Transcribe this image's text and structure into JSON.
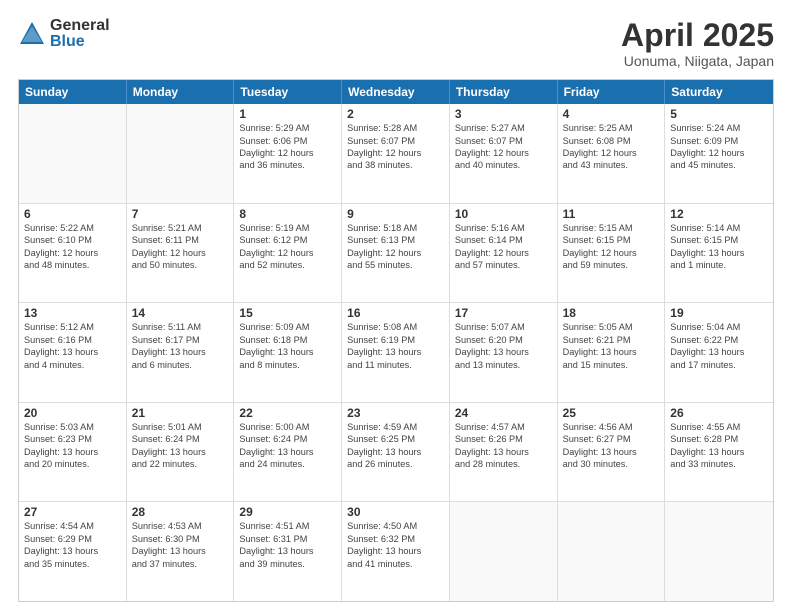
{
  "logo": {
    "general": "General",
    "blue": "Blue"
  },
  "title": "April 2025",
  "subtitle": "Uonuma, Niigata, Japan",
  "headers": [
    "Sunday",
    "Monday",
    "Tuesday",
    "Wednesday",
    "Thursday",
    "Friday",
    "Saturday"
  ],
  "weeks": [
    [
      {
        "day": "",
        "lines": []
      },
      {
        "day": "",
        "lines": []
      },
      {
        "day": "1",
        "lines": [
          "Sunrise: 5:29 AM",
          "Sunset: 6:06 PM",
          "Daylight: 12 hours",
          "and 36 minutes."
        ]
      },
      {
        "day": "2",
        "lines": [
          "Sunrise: 5:28 AM",
          "Sunset: 6:07 PM",
          "Daylight: 12 hours",
          "and 38 minutes."
        ]
      },
      {
        "day": "3",
        "lines": [
          "Sunrise: 5:27 AM",
          "Sunset: 6:07 PM",
          "Daylight: 12 hours",
          "and 40 minutes."
        ]
      },
      {
        "day": "4",
        "lines": [
          "Sunrise: 5:25 AM",
          "Sunset: 6:08 PM",
          "Daylight: 12 hours",
          "and 43 minutes."
        ]
      },
      {
        "day": "5",
        "lines": [
          "Sunrise: 5:24 AM",
          "Sunset: 6:09 PM",
          "Daylight: 12 hours",
          "and 45 minutes."
        ]
      }
    ],
    [
      {
        "day": "6",
        "lines": [
          "Sunrise: 5:22 AM",
          "Sunset: 6:10 PM",
          "Daylight: 12 hours",
          "and 48 minutes."
        ]
      },
      {
        "day": "7",
        "lines": [
          "Sunrise: 5:21 AM",
          "Sunset: 6:11 PM",
          "Daylight: 12 hours",
          "and 50 minutes."
        ]
      },
      {
        "day": "8",
        "lines": [
          "Sunrise: 5:19 AM",
          "Sunset: 6:12 PM",
          "Daylight: 12 hours",
          "and 52 minutes."
        ]
      },
      {
        "day": "9",
        "lines": [
          "Sunrise: 5:18 AM",
          "Sunset: 6:13 PM",
          "Daylight: 12 hours",
          "and 55 minutes."
        ]
      },
      {
        "day": "10",
        "lines": [
          "Sunrise: 5:16 AM",
          "Sunset: 6:14 PM",
          "Daylight: 12 hours",
          "and 57 minutes."
        ]
      },
      {
        "day": "11",
        "lines": [
          "Sunrise: 5:15 AM",
          "Sunset: 6:15 PM",
          "Daylight: 12 hours",
          "and 59 minutes."
        ]
      },
      {
        "day": "12",
        "lines": [
          "Sunrise: 5:14 AM",
          "Sunset: 6:15 PM",
          "Daylight: 13 hours",
          "and 1 minute."
        ]
      }
    ],
    [
      {
        "day": "13",
        "lines": [
          "Sunrise: 5:12 AM",
          "Sunset: 6:16 PM",
          "Daylight: 13 hours",
          "and 4 minutes."
        ]
      },
      {
        "day": "14",
        "lines": [
          "Sunrise: 5:11 AM",
          "Sunset: 6:17 PM",
          "Daylight: 13 hours",
          "and 6 minutes."
        ]
      },
      {
        "day": "15",
        "lines": [
          "Sunrise: 5:09 AM",
          "Sunset: 6:18 PM",
          "Daylight: 13 hours",
          "and 8 minutes."
        ]
      },
      {
        "day": "16",
        "lines": [
          "Sunrise: 5:08 AM",
          "Sunset: 6:19 PM",
          "Daylight: 13 hours",
          "and 11 minutes."
        ]
      },
      {
        "day": "17",
        "lines": [
          "Sunrise: 5:07 AM",
          "Sunset: 6:20 PM",
          "Daylight: 13 hours",
          "and 13 minutes."
        ]
      },
      {
        "day": "18",
        "lines": [
          "Sunrise: 5:05 AM",
          "Sunset: 6:21 PM",
          "Daylight: 13 hours",
          "and 15 minutes."
        ]
      },
      {
        "day": "19",
        "lines": [
          "Sunrise: 5:04 AM",
          "Sunset: 6:22 PM",
          "Daylight: 13 hours",
          "and 17 minutes."
        ]
      }
    ],
    [
      {
        "day": "20",
        "lines": [
          "Sunrise: 5:03 AM",
          "Sunset: 6:23 PM",
          "Daylight: 13 hours",
          "and 20 minutes."
        ]
      },
      {
        "day": "21",
        "lines": [
          "Sunrise: 5:01 AM",
          "Sunset: 6:24 PM",
          "Daylight: 13 hours",
          "and 22 minutes."
        ]
      },
      {
        "day": "22",
        "lines": [
          "Sunrise: 5:00 AM",
          "Sunset: 6:24 PM",
          "Daylight: 13 hours",
          "and 24 minutes."
        ]
      },
      {
        "day": "23",
        "lines": [
          "Sunrise: 4:59 AM",
          "Sunset: 6:25 PM",
          "Daylight: 13 hours",
          "and 26 minutes."
        ]
      },
      {
        "day": "24",
        "lines": [
          "Sunrise: 4:57 AM",
          "Sunset: 6:26 PM",
          "Daylight: 13 hours",
          "and 28 minutes."
        ]
      },
      {
        "day": "25",
        "lines": [
          "Sunrise: 4:56 AM",
          "Sunset: 6:27 PM",
          "Daylight: 13 hours",
          "and 30 minutes."
        ]
      },
      {
        "day": "26",
        "lines": [
          "Sunrise: 4:55 AM",
          "Sunset: 6:28 PM",
          "Daylight: 13 hours",
          "and 33 minutes."
        ]
      }
    ],
    [
      {
        "day": "27",
        "lines": [
          "Sunrise: 4:54 AM",
          "Sunset: 6:29 PM",
          "Daylight: 13 hours",
          "and 35 minutes."
        ]
      },
      {
        "day": "28",
        "lines": [
          "Sunrise: 4:53 AM",
          "Sunset: 6:30 PM",
          "Daylight: 13 hours",
          "and 37 minutes."
        ]
      },
      {
        "day": "29",
        "lines": [
          "Sunrise: 4:51 AM",
          "Sunset: 6:31 PM",
          "Daylight: 13 hours",
          "and 39 minutes."
        ]
      },
      {
        "day": "30",
        "lines": [
          "Sunrise: 4:50 AM",
          "Sunset: 6:32 PM",
          "Daylight: 13 hours",
          "and 41 minutes."
        ]
      },
      {
        "day": "",
        "lines": []
      },
      {
        "day": "",
        "lines": []
      },
      {
        "day": "",
        "lines": []
      }
    ]
  ]
}
